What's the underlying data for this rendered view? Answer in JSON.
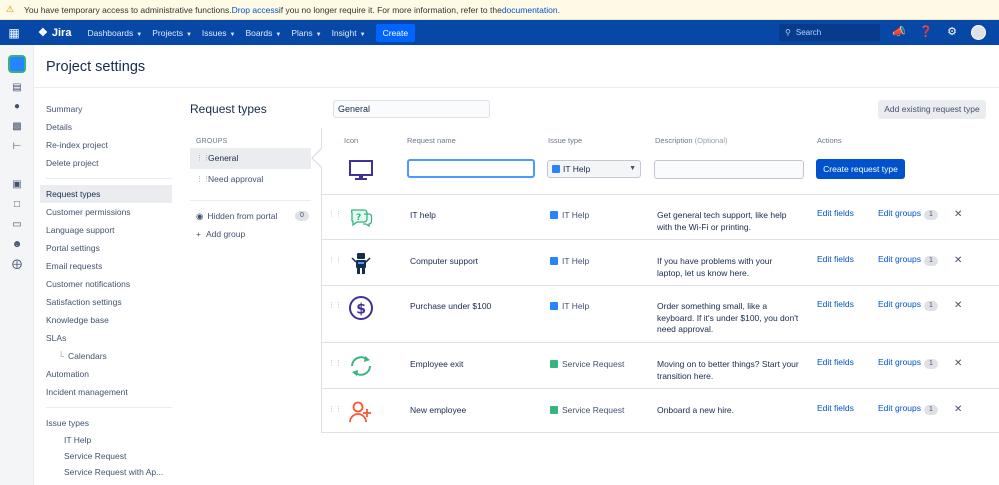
{
  "banner": {
    "text_before": "You have temporary access to administrative functions. ",
    "link_drop": "Drop access",
    "text_middle": " if you no longer require it. For more information, refer to the ",
    "link_docs": "documentation",
    "text_after": "."
  },
  "topnav": {
    "logo": "Jira",
    "items": [
      "Dashboards",
      "Projects",
      "Issues",
      "Boards",
      "Plans",
      "Insight"
    ],
    "create": "Create",
    "search_placeholder": "Search"
  },
  "page": {
    "title": "Project settings"
  },
  "leftnav": {
    "group1": [
      "Summary",
      "Details",
      "Re-index project",
      "Delete project"
    ],
    "group2": [
      "Request types",
      "Customer permissions",
      "Language support",
      "Portal settings",
      "Email requests",
      "Customer notifications",
      "Satisfaction settings",
      "Knowledge base",
      "SLAs"
    ],
    "calendars": "Calendars",
    "group3": [
      "Automation",
      "Incident management"
    ],
    "issue_types_label": "Issue types",
    "issue_types": [
      "IT Help",
      "Service Request",
      "Service Request with Ap..."
    ]
  },
  "request_types": {
    "title": "Request types",
    "group_name": "General",
    "add_existing": "Add existing request type",
    "groups_header": "GROUPS",
    "groups": [
      "General",
      "Need approval"
    ],
    "hidden_label": "Hidden from portal",
    "hidden_count": "0",
    "add_group": "Add group"
  },
  "table": {
    "headers": {
      "icon": "Icon",
      "name": "Request name",
      "type": "Issue type",
      "desc": "Description",
      "desc_opt": "(Optional)",
      "actions": "Actions"
    },
    "new_row": {
      "type_selected": "IT Help",
      "create_button": "Create request type"
    },
    "edit_fields": "Edit fields",
    "edit_groups": "Edit groups",
    "rows": [
      {
        "name": "IT help",
        "type": "IT Help",
        "desc": "Get general tech support, like help with the Wi-Fi or printing.",
        "groups": "1"
      },
      {
        "name": "Computer support",
        "type": "IT Help",
        "desc": "If you have problems with your laptop, let us know here.",
        "groups": "1"
      },
      {
        "name": "Purchase under $100",
        "type": "IT Help",
        "desc": "Order something small, like a keyboard. If it's under $100, you don't need approval.",
        "groups": "1"
      },
      {
        "name": "Employee exit",
        "type": "Service Request",
        "desc": "Moving on to better things? Start your transition here.",
        "groups": "1"
      },
      {
        "name": "New employee",
        "type": "Service Request",
        "desc": "Onboard a new hire.",
        "groups": "1"
      }
    ]
  },
  "colors": {
    "nav_bg": "#0747a6",
    "primary": "#0052cc",
    "it_help": "#2684ff",
    "service_request": "#36b37e"
  }
}
